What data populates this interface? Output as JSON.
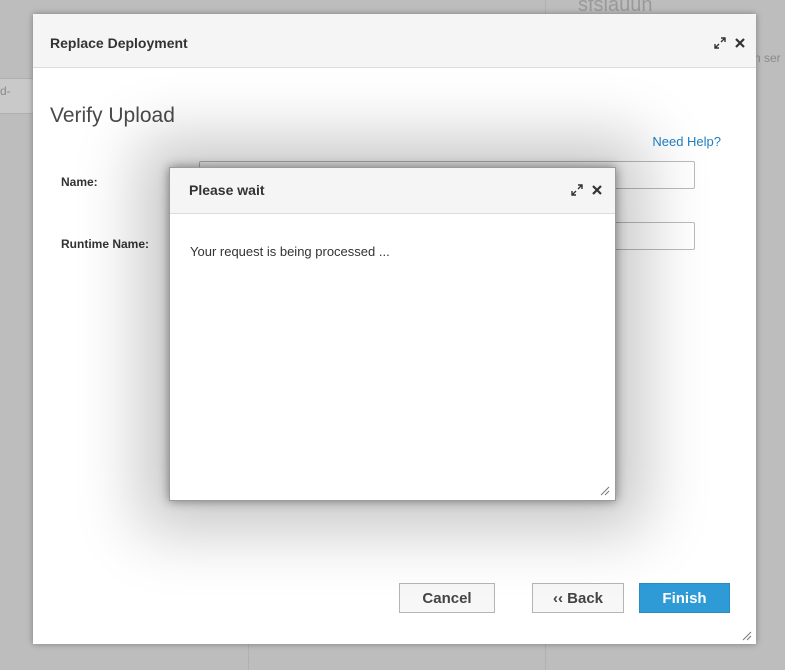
{
  "background": {
    "left_fragment": "d-",
    "right_fragment": "n ser",
    "top_fragment": "sfsiauun"
  },
  "dialog": {
    "title": "Replace Deployment",
    "heading": "Verify Upload",
    "need_help": "Need Help?",
    "fields": [
      {
        "label": "Name:",
        "value": ""
      },
      {
        "label": "Runtime Name:",
        "value": ""
      }
    ],
    "buttons": {
      "cancel": "Cancel",
      "back": "‹‹ Back",
      "finish": "Finish"
    },
    "icons": {
      "expand": "expand-icon",
      "close": "close-icon"
    }
  },
  "modal": {
    "title": "Please wait",
    "message": "Your request is being processed ..."
  },
  "colors": {
    "accent": "#2f9bd6",
    "link": "#1f7fc2",
    "overlay": "#a9a9a9"
  }
}
